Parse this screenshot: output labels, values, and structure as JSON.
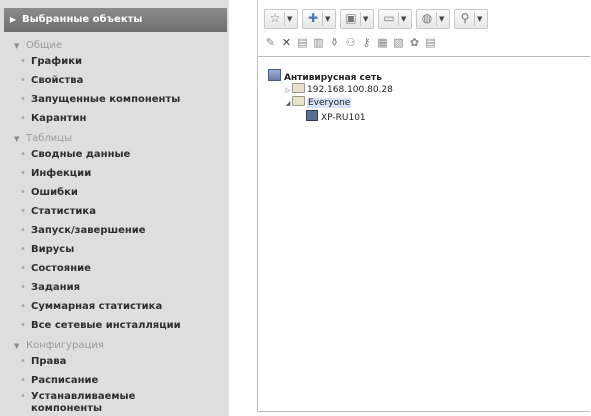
{
  "sidebar": {
    "header": "Выбранные объекты",
    "sections": [
      {
        "title": "Общие",
        "items": [
          "Графики",
          "Свойства",
          "Запущенные компоненты",
          "Карантин"
        ]
      },
      {
        "title": "Таблицы",
        "items": [
          "Сводные данные",
          "Инфекции",
          "Ошибки",
          "Статистика",
          "Запуск/завершение",
          "Вирусы",
          "Состояние",
          "Задания",
          "Суммарная статистика",
          "Все сетевые инсталляции"
        ]
      },
      {
        "title": "Конфигурация",
        "items": [
          "Права",
          "Расписание",
          "Устанавливаемые компоненты"
        ]
      }
    ]
  },
  "toolbar": {
    "row1": [
      "star-icon",
      "add-icon",
      "properties-icon",
      "folder-icon",
      "shield-icon",
      "search-icon"
    ],
    "row2": [
      "pencil-icon",
      "delete-icon",
      "cut-icon",
      "paste-icon",
      "filter-icon",
      "user-search-icon",
      "key-icon",
      "monitor-icon",
      "remove-monitor-icon",
      "flower-icon",
      "server-icon"
    ]
  },
  "tree": {
    "root": "Антивирусная сеть",
    "nodes": [
      {
        "label": "192.168.100.80.28",
        "depth": 1,
        "expanded": false
      },
      {
        "label": "Everyone",
        "depth": 1,
        "expanded": true
      },
      {
        "label": "XP-RU101",
        "depth": 2,
        "expanded": false
      }
    ]
  },
  "colors": {
    "sidebar_bg": "#dedede",
    "header_bg": "#7c7c7c",
    "section_text": "#9a9a9a",
    "item_text": "#2e2e2e"
  }
}
